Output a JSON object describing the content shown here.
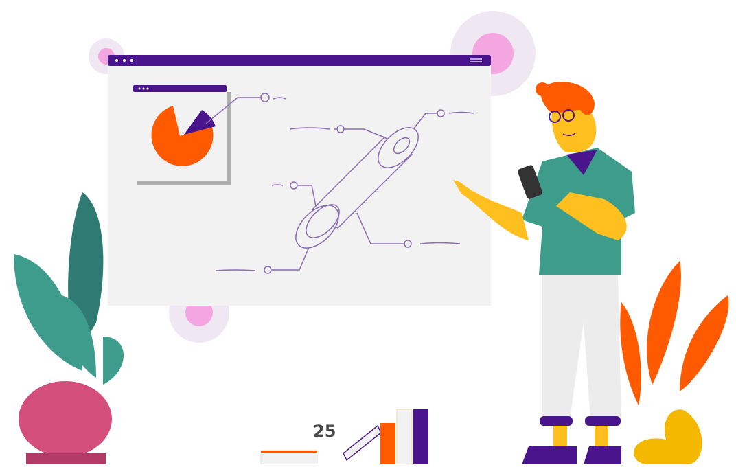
{
  "page": {
    "number": "25"
  },
  "colors": {
    "purple": "#4a148c",
    "orange": "#ff5a00",
    "teal": "#3e9c8c",
    "pink": "#f4a6e0",
    "gear": "#f1eaf4",
    "skin": "#ffbf1f",
    "hair": "#ff5a00",
    "shirt": "#3d9c8a",
    "pants": "#ececec",
    "screen": "#f2f2f2"
  },
  "icons": [
    "gear-icon",
    "pie-chart-icon",
    "phone-icon",
    "window-dots-icon",
    "hamburger-icon"
  ]
}
